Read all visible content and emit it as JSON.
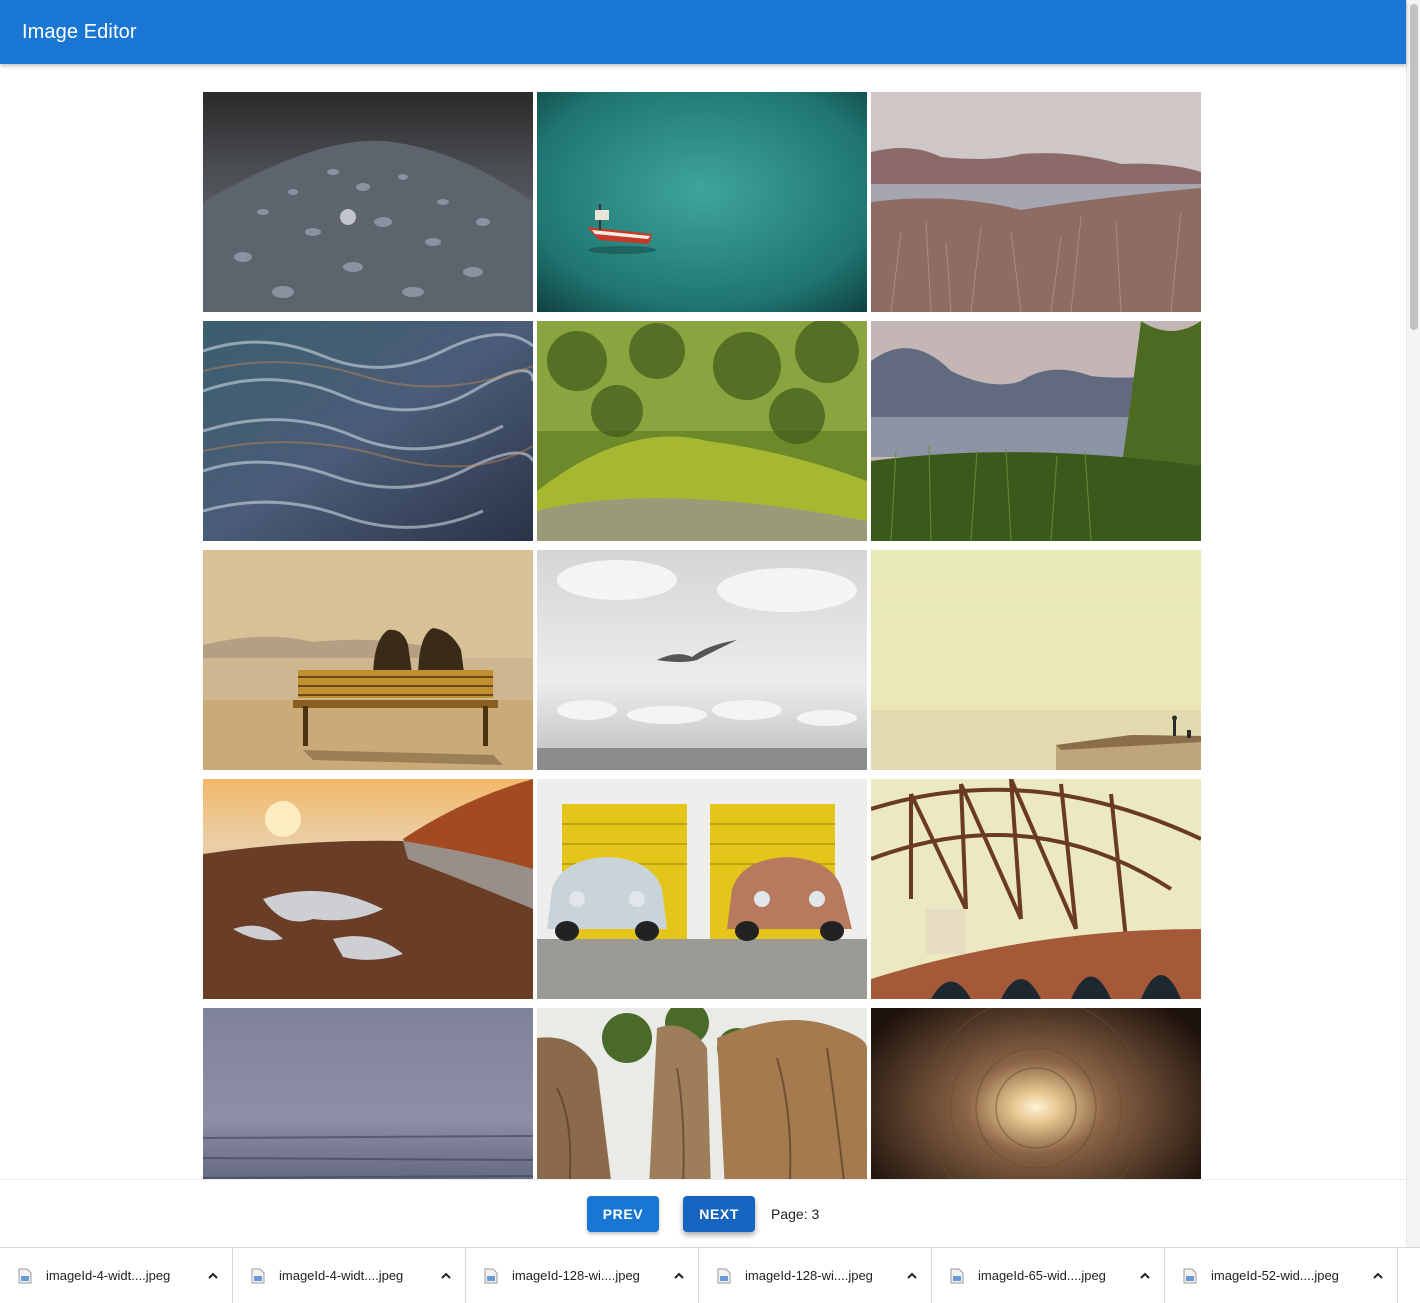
{
  "app": {
    "title": "Image Editor"
  },
  "gallery": {
    "tiles": [
      {
        "icon": "water-droplets-photo"
      },
      {
        "icon": "boat-on-sea-photo"
      },
      {
        "icon": "lake-hills-grass-photo"
      },
      {
        "icon": "rippling-water-photo"
      },
      {
        "icon": "mossy-forest-photo"
      },
      {
        "icon": "mountain-lake-reeds-photo"
      },
      {
        "icon": "couple-on-bench-photo"
      },
      {
        "icon": "seagull-clouds-photo"
      },
      {
        "icon": "hazy-sea-pier-photo"
      },
      {
        "icon": "sunset-puddle-road-photo"
      },
      {
        "icon": "vintage-cars-photo"
      },
      {
        "icon": "bridge-arches-photo"
      },
      {
        "icon": "misty-sea-photo"
      },
      {
        "icon": "sandstone-rocks-photo"
      },
      {
        "icon": "tunnel-light-photo"
      }
    ]
  },
  "pager": {
    "prev_label": "PREV",
    "next_label": "NEXT",
    "page_label": "Page: 3"
  },
  "downloads": {
    "items": [
      {
        "name": "imageId-4-widt....jpeg"
      },
      {
        "name": "imageId-4-widt....jpeg"
      },
      {
        "name": "imageId-128-wi....jpeg"
      },
      {
        "name": "imageId-128-wi....jpeg"
      },
      {
        "name": "imageId-65-wid....jpeg"
      },
      {
        "name": "imageId-52-wid....jpeg"
      }
    ]
  },
  "colors": {
    "primary": "#1976d2",
    "primary_dark": "#1565c0"
  }
}
